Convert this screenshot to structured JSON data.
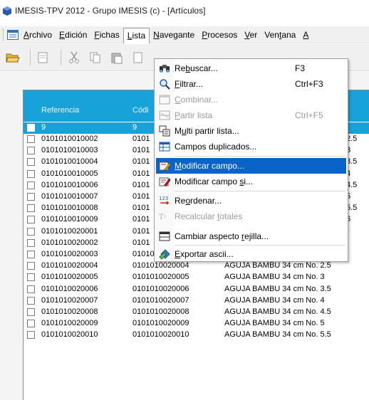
{
  "window": {
    "title": "IMESIS-TPV 2012 - Grupo IMESIS (c) - [Artículos]"
  },
  "menubar": {
    "items": [
      {
        "pre": "",
        "key": "A",
        "post": "rchivo"
      },
      {
        "pre": "",
        "key": "E",
        "post": "dición"
      },
      {
        "pre": "",
        "key": "F",
        "post": "ichas"
      },
      {
        "pre": "",
        "key": "L",
        "post": "ista"
      },
      {
        "pre": "",
        "key": "N",
        "post": "avegante"
      },
      {
        "pre": "",
        "key": "P",
        "post": "rocesos"
      },
      {
        "pre": "",
        "key": "V",
        "post": "er"
      },
      {
        "pre": "Ven",
        "key": "t",
        "post": "ana"
      },
      {
        "pre": "",
        "key": "A",
        "post": ""
      }
    ]
  },
  "grid": {
    "headers": [
      "Referencia",
      "Códi"
    ],
    "selected_row": {
      "ref": "9",
      "code": "9"
    },
    "rows": [
      {
        "ref": "0101010010002",
        "code": "0101",
        "desc": "",
        "extra": "2.5"
      },
      {
        "ref": "0101010010003",
        "code": "0101",
        "desc": "",
        "extra": "3"
      },
      {
        "ref": "0101010010004",
        "code": "0101",
        "desc": "",
        "extra": "3.5"
      },
      {
        "ref": "0101010010005",
        "code": "0101",
        "desc": "",
        "extra": "4"
      },
      {
        "ref": "0101010010006",
        "code": "0101",
        "desc": "",
        "extra": "4.5"
      },
      {
        "ref": "0101010010007",
        "code": "0101",
        "desc": "",
        "extra": "5"
      },
      {
        "ref": "0101010010008",
        "code": "0101",
        "desc": "",
        "extra": "5.5"
      },
      {
        "ref": "0101010010009",
        "code": "0101",
        "desc": "",
        "extra": "6"
      },
      {
        "ref": "0101010020001",
        "code": "0101",
        "desc": "",
        "extra": ""
      },
      {
        "ref": "0101010020002",
        "code": "0101",
        "desc": "",
        "extra": ""
      },
      {
        "ref": "0101010020003",
        "code": "0101010020003",
        "desc": "AGUJA BAMBU 34 cm No. 2",
        "extra": ""
      },
      {
        "ref": "0101010020004",
        "code": "0101010020004",
        "desc": "AGUJA BAMBU 34 cm No. 2.5",
        "extra": ""
      },
      {
        "ref": "0101010020005",
        "code": "0101010020005",
        "desc": "AGUJA BAMBU 34 cm No. 3",
        "extra": ""
      },
      {
        "ref": "0101010020006",
        "code": "0101010020006",
        "desc": "AGUJA BAMBU 34 cm No. 3.5",
        "extra": ""
      },
      {
        "ref": "0101010020007",
        "code": "0101010020007",
        "desc": "AGUJA BAMBU 34 cm No. 4",
        "extra": ""
      },
      {
        "ref": "0101010020008",
        "code": "0101010020008",
        "desc": "AGUJA BAMBU 34 cm No. 4.5",
        "extra": ""
      },
      {
        "ref": "0101010020009",
        "code": "0101010020009",
        "desc": "AGUJA BAMBU 34 cm No. 5",
        "extra": ""
      },
      {
        "ref": "0101010020010",
        "code": "0101010020010",
        "desc": "AGUJA BAMBU 34 cm No. 5.5",
        "extra": ""
      }
    ]
  },
  "dropdown": {
    "items": [
      {
        "pre": "Re",
        "key": "b",
        "post": "uscar...",
        "shortcut": "F3",
        "icon": "binoculars-icon",
        "state": "normal"
      },
      {
        "pre": "",
        "key": "F",
        "post": "iltrar...",
        "shortcut": "Ctrl+F3",
        "icon": "magnifier-icon",
        "state": "normal"
      },
      {
        "pre": "",
        "key": "C",
        "post": "ombinar...",
        "shortcut": "",
        "icon": "combine-icon",
        "state": "disabled"
      },
      {
        "pre": "",
        "key": "P",
        "post": "artir lista",
        "shortcut": "Ctrl+F5",
        "icon": "split-list-icon",
        "state": "disabled"
      },
      {
        "pre": "M",
        "key": "u",
        "post": "lti partir lista...",
        "shortcut": "",
        "icon": "multi-split-icon",
        "state": "normal"
      },
      {
        "pre": "Campos duplicados...",
        "key": "",
        "post": "",
        "shortcut": "",
        "icon": "duplicate-fields-icon",
        "state": "normal"
      },
      {
        "pre": "",
        "key": "M",
        "post": "odificar campo...",
        "shortcut": "",
        "icon": "edit-field-icon",
        "state": "highlighted"
      },
      {
        "pre": "Modificar campo ",
        "key": "s",
        "post": "i...",
        "shortcut": "",
        "icon": "edit-field-if-icon",
        "state": "normal"
      },
      {
        "pre": "Re",
        "key": "o",
        "post": "rdenar...",
        "shortcut": "",
        "icon": "reorder-icon",
        "state": "normal"
      },
      {
        "pre": "Recalcular ",
        "key": "t",
        "post": "otales",
        "shortcut": "",
        "icon": "recalculate-icon",
        "state": "disabled"
      },
      {
        "pre": "Cambiar aspecto ",
        "key": "r",
        "post": "ejilla...",
        "shortcut": "",
        "icon": "grid-look-icon",
        "state": "normal"
      },
      {
        "pre": "",
        "key": "E",
        "post": "xportar ascii...",
        "shortcut": "",
        "icon": "export-icon",
        "state": "normal"
      }
    ]
  },
  "colors": {
    "header_blue": "#17a3da",
    "menu_highlight": "#0a63c7"
  }
}
